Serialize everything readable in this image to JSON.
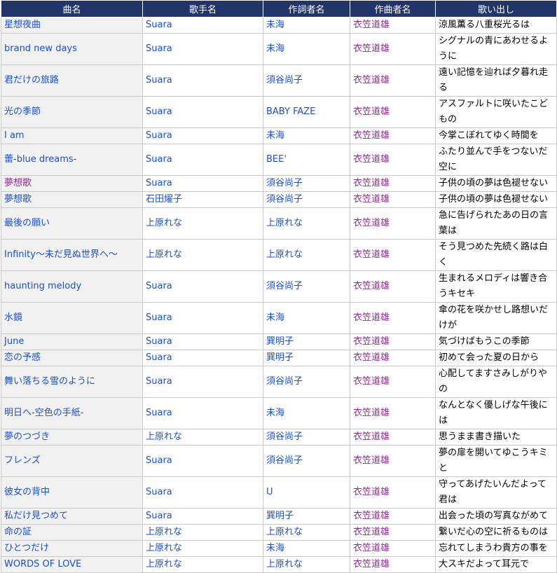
{
  "headers": [
    "曲名",
    "歌手名",
    "作詞者名",
    "作曲者名",
    "歌い出し"
  ],
  "rows": [
    {
      "song": "星想夜曲",
      "singer": "Suara",
      "lyricist": "未海",
      "composer": "衣笠道雄",
      "first_line": "涼風薫る八重桜光るは"
    },
    {
      "song": "brand new days",
      "singer": "Suara",
      "lyricist": "未海",
      "composer": "衣笠道雄",
      "first_line": "シグナルの青にあわせるように"
    },
    {
      "song": "君だけの旅路",
      "singer": "Suara",
      "lyricist": "須谷尚子",
      "composer": "衣笠道雄",
      "first_line": "遠い記憶を辿れば夕暮れ走る"
    },
    {
      "song": "光の季節",
      "singer": "Suara",
      "lyricist": "BABY FAZE",
      "composer": "衣笠道雄",
      "first_line": "アスファルトに咲いたこどもの"
    },
    {
      "song": "I am",
      "singer": "Suara",
      "lyricist": "未海",
      "composer": "衣笠道雄",
      "first_line": "今掌こぼれてゆく時間を"
    },
    {
      "song": "蕾-blue dreams-",
      "singer": "Suara",
      "lyricist": "BEE'",
      "composer": "衣笠道雄",
      "first_line": "ふたり並んで手をつないだ空に"
    },
    {
      "song": "夢想歌",
      "singer": "Suara",
      "lyricist": "須谷尚子",
      "composer": "衣笠道雄",
      "first_line": "子供の頃の夢は色褪せない"
    },
    {
      "song": "夢想歌",
      "singer": "石田燿子",
      "lyricist": "須谷尚子",
      "composer": "衣笠道雄",
      "first_line": "子供の頃の夢は色褪せない"
    },
    {
      "song": "最後の願い",
      "singer": "上原れな",
      "lyricist": "上原れな",
      "composer": "衣笠道雄",
      "first_line": "急に告げられたあの日の言葉は"
    },
    {
      "song": "Infinity～未だ見ぬ世界へ～",
      "singer": "上原れな",
      "lyricist": "上原れな",
      "composer": "衣笠道雄",
      "first_line": "そう見つめた先続く路は白く"
    },
    {
      "song": "haunting melody",
      "singer": "Suara",
      "lyricist": "須谷尚子",
      "composer": "衣笠道雄",
      "first_line": "生まれるメロディは響き合うキセキ"
    },
    {
      "song": "水鏡",
      "singer": "Suara",
      "lyricist": "未海",
      "composer": "衣笠道雄",
      "first_line": "傘の花を咲かせし路想いだけが"
    },
    {
      "song": "June",
      "singer": "Suara",
      "lyricist": "巽明子",
      "composer": "衣笠道雄",
      "first_line": "気づけばもうこの季節"
    },
    {
      "song": "恋の予感",
      "singer": "Suara",
      "lyricist": "巽明子",
      "composer": "衣笠道雄",
      "first_line": "初めて会った夏の日から"
    },
    {
      "song": "舞い落ちる雪のように",
      "singer": "Suara",
      "lyricist": "須谷尚子",
      "composer": "衣笠道雄",
      "first_line": "心配してますさみしがりやの"
    },
    {
      "song": "明日へ-空色の手紙-",
      "singer": "Suara",
      "lyricist": "未海",
      "composer": "衣笠道雄",
      "first_line": "なんとなく優しげな午後には"
    },
    {
      "song": "夢のつづき",
      "singer": "上原れな",
      "lyricist": "須谷尚子",
      "composer": "衣笠道雄",
      "first_line": "思うまま書き描いた"
    },
    {
      "song": "フレンズ",
      "singer": "Suara",
      "lyricist": "須谷尚子",
      "composer": "衣笠道雄",
      "first_line": "夢の扉を開いてゆこうキミと"
    },
    {
      "song": "彼女の背中",
      "singer": "Suara",
      "lyricist": "U",
      "composer": "衣笠道雄",
      "first_line": "守ってあげたいんだよって君は"
    },
    {
      "song": "私だけ見つめて",
      "singer": "Suara",
      "lyricist": "巽明子",
      "composer": "衣笠道雄",
      "first_line": "出会った頃の写真ながめて"
    },
    {
      "song": "命の証",
      "singer": "上原れな",
      "lyricist": "上原れな",
      "composer": "衣笠道雄",
      "first_line": "繋いだ心の空に祈るものは"
    },
    {
      "song": "ひとつだけ",
      "singer": "上原れな",
      "lyricist": "未海",
      "composer": "衣笠道雄",
      "first_line": "忘れてしまうわ貴方の事を"
    },
    {
      "song": "WORDS OF LOVE",
      "singer": "上原れな",
      "lyricist": "上原れな",
      "composer": "衣笠道雄",
      "first_line": "大スキだよって耳元で"
    }
  ],
  "colors": {
    "header_bg": "#22346a",
    "link": "#1a4fd6",
    "visited": "#8e2a8e",
    "song_cell_bg": "#f1f1f1"
  }
}
